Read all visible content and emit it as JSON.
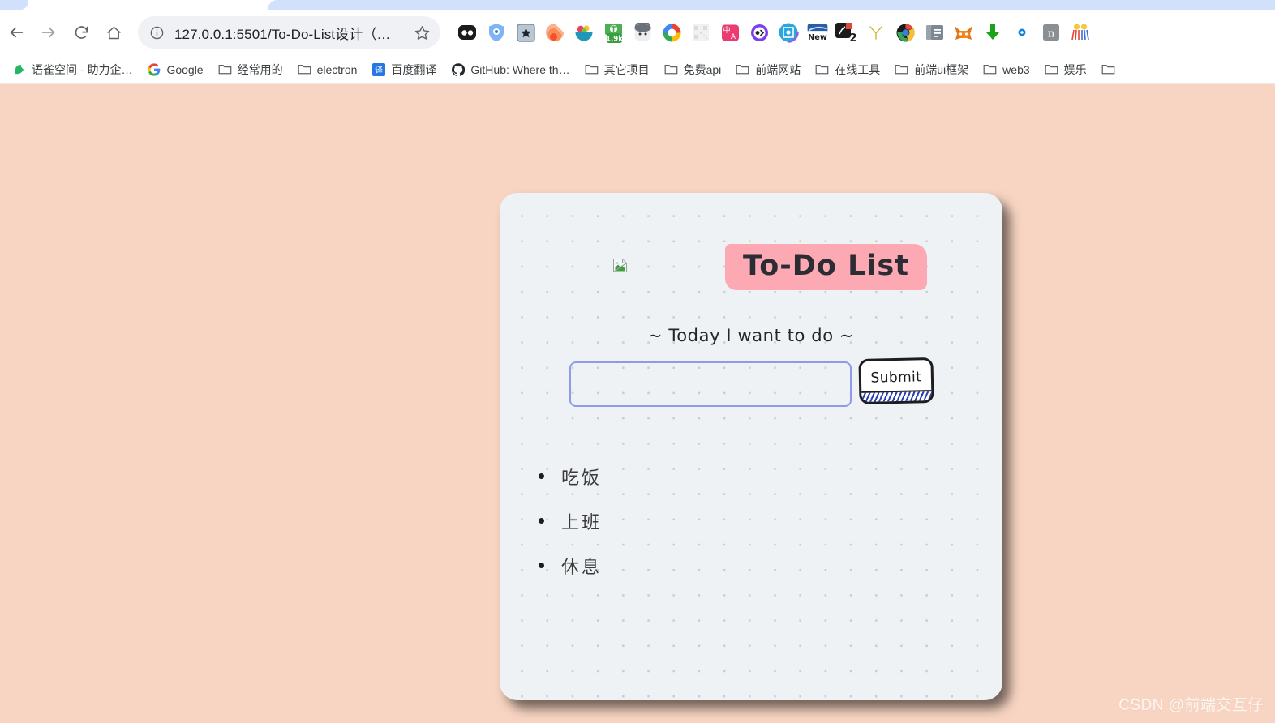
{
  "browser": {
    "nav": {
      "back_label": "Back",
      "forward_label": "Forward",
      "reload_label": "Reload",
      "home_label": "Home"
    },
    "omnibox": {
      "url": "127.0.0.1:5501/To-Do-List设计（…",
      "info_icon": "info-circle-icon",
      "star_icon": "bookmark-star-icon"
    },
    "extensions": [
      {
        "name": "momentum-icon"
      },
      {
        "name": "shield-privacy-icon"
      },
      {
        "name": "star-badge-icon"
      },
      {
        "name": "feedly-icon"
      },
      {
        "name": "fruit-bowl-icon"
      },
      {
        "name": "counter-badge-icon",
        "badge": "1.9k"
      },
      {
        "name": "avatar-grey-icon"
      },
      {
        "name": "color-ring-icon"
      },
      {
        "name": "qr-code-icon"
      },
      {
        "name": "translate-pink-icon"
      },
      {
        "name": "eye-purple-icon"
      },
      {
        "name": "screenshot-blue-icon"
      },
      {
        "name": "new-tab-icon",
        "badge": "New"
      },
      {
        "name": "extension-two-icon",
        "badge": "2"
      },
      {
        "name": "y-branch-icon"
      },
      {
        "name": "chrome-refresh-icon"
      },
      {
        "name": "copy-pages-icon"
      },
      {
        "name": "metamask-fox-icon"
      },
      {
        "name": "download-green-icon"
      },
      {
        "name": "eye-blue-icon"
      },
      {
        "name": "notion-icon"
      },
      {
        "name": "confetti-icon"
      }
    ],
    "bookmarks": [
      {
        "label": "语雀空间 - 助力企…",
        "icon": "yuque-icon"
      },
      {
        "label": "Google",
        "icon": "google-icon"
      },
      {
        "label": "经常用的",
        "icon": "folder-icon"
      },
      {
        "label": "electron",
        "icon": "folder-icon"
      },
      {
        "label": "百度翻译",
        "icon": "baidu-translate-icon"
      },
      {
        "label": "GitHub: Where th…",
        "icon": "github-icon"
      },
      {
        "label": "其它项目",
        "icon": "folder-icon"
      },
      {
        "label": "免费api",
        "icon": "folder-icon"
      },
      {
        "label": "前端网站",
        "icon": "folder-icon"
      },
      {
        "label": "在线工具",
        "icon": "folder-icon"
      },
      {
        "label": "前端ui框架",
        "icon": "folder-icon"
      },
      {
        "label": "web3",
        "icon": "folder-icon"
      },
      {
        "label": "娱乐",
        "icon": "folder-icon"
      },
      {
        "label": "",
        "icon": "folder-icon"
      }
    ]
  },
  "app": {
    "title": "To-Do List",
    "subtitle": "~ Today I want to do ~",
    "header_image": "broken-image-icon",
    "input": {
      "value": "",
      "placeholder": ""
    },
    "submit_label": "Submit",
    "todos": [
      {
        "text": "吃饭"
      },
      {
        "text": "上班"
      },
      {
        "text": "休息"
      }
    ]
  },
  "watermark": "CSDN @前端交互仔",
  "colors": {
    "page_background": "#f8d5c2",
    "card_background": "#eff2f5",
    "title_highlight": "#fca9b3",
    "input_border": "#8f9bea",
    "submit_stripe": "#2b3fb5",
    "dot_grid": "#c9ccd1"
  }
}
